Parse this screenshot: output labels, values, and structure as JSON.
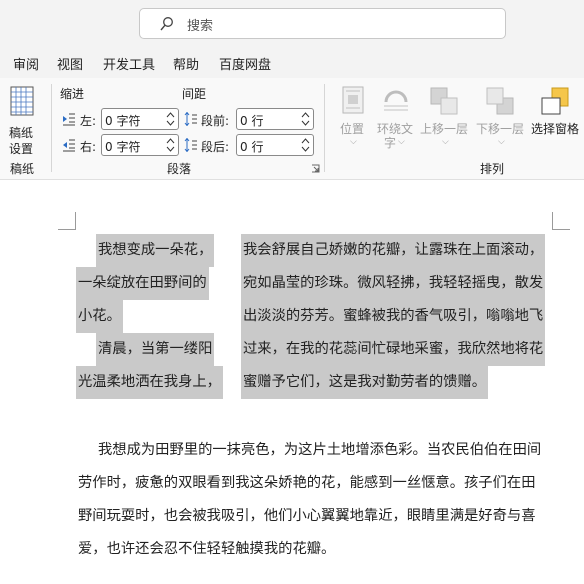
{
  "search": {
    "placeholder": "搜索"
  },
  "menu": [
    "审阅",
    "视图",
    "开发工具",
    "帮助",
    "百度网盘"
  ],
  "ribbon": {
    "paper_group": {
      "button_line1": "稿纸",
      "button_line2": "设置",
      "group_label": "稿纸"
    },
    "paragraph_group": {
      "indent_title": "缩进",
      "spacing_title": "间距",
      "left_label": "左:",
      "left_value": "0 字符",
      "right_label": "右:",
      "right_value": "0 字符",
      "before_label": "段前:",
      "before_value": "0 行",
      "after_label": "段后:",
      "after_value": "0 行",
      "group_label": "段落"
    },
    "arrange_group": {
      "position": "位置",
      "wrap_line1": "环绕文",
      "wrap_line2": "字",
      "bring_forward": "上移一层",
      "send_backward": "下移一层",
      "selection_pane": "选择窗格",
      "group_label": "排列"
    }
  },
  "document": {
    "col1_lines": [
      "我想变成一朵花，",
      "一朵绽放在田野间的",
      "小花。",
      "清晨，当第一缕阳",
      "光温柔地洒在我身上，"
    ],
    "col2_lines": [
      "我会舒展自己娇嫩的花瓣，让露珠在上面滚动，",
      "宛如晶莹的珍珠。微风轻拂，我轻轻摇曳，散发",
      "出淡淡的芬芳。蜜蜂被我的香气吸引，嗡嗡地飞",
      "过来，在我的花蕊间忙碌地采蜜，我欣然地将花",
      "蜜赠予它们，这是我对勤劳者的馈赠。"
    ],
    "para2_lines": [
      "我想成为田野里的一抹亮色，为这片土地增添色彩。当农民伯伯在田间",
      "劳作时，疲惫的双眼看到我这朵娇艳的花，能感到一丝惬意。孩子们在田",
      "野间玩耍时，也会被我吸引，他们小心翼翼地靠近，眼睛里满是好奇与喜",
      "爱，也许还会忍不住轻轻触摸我的花瓣。"
    ]
  }
}
